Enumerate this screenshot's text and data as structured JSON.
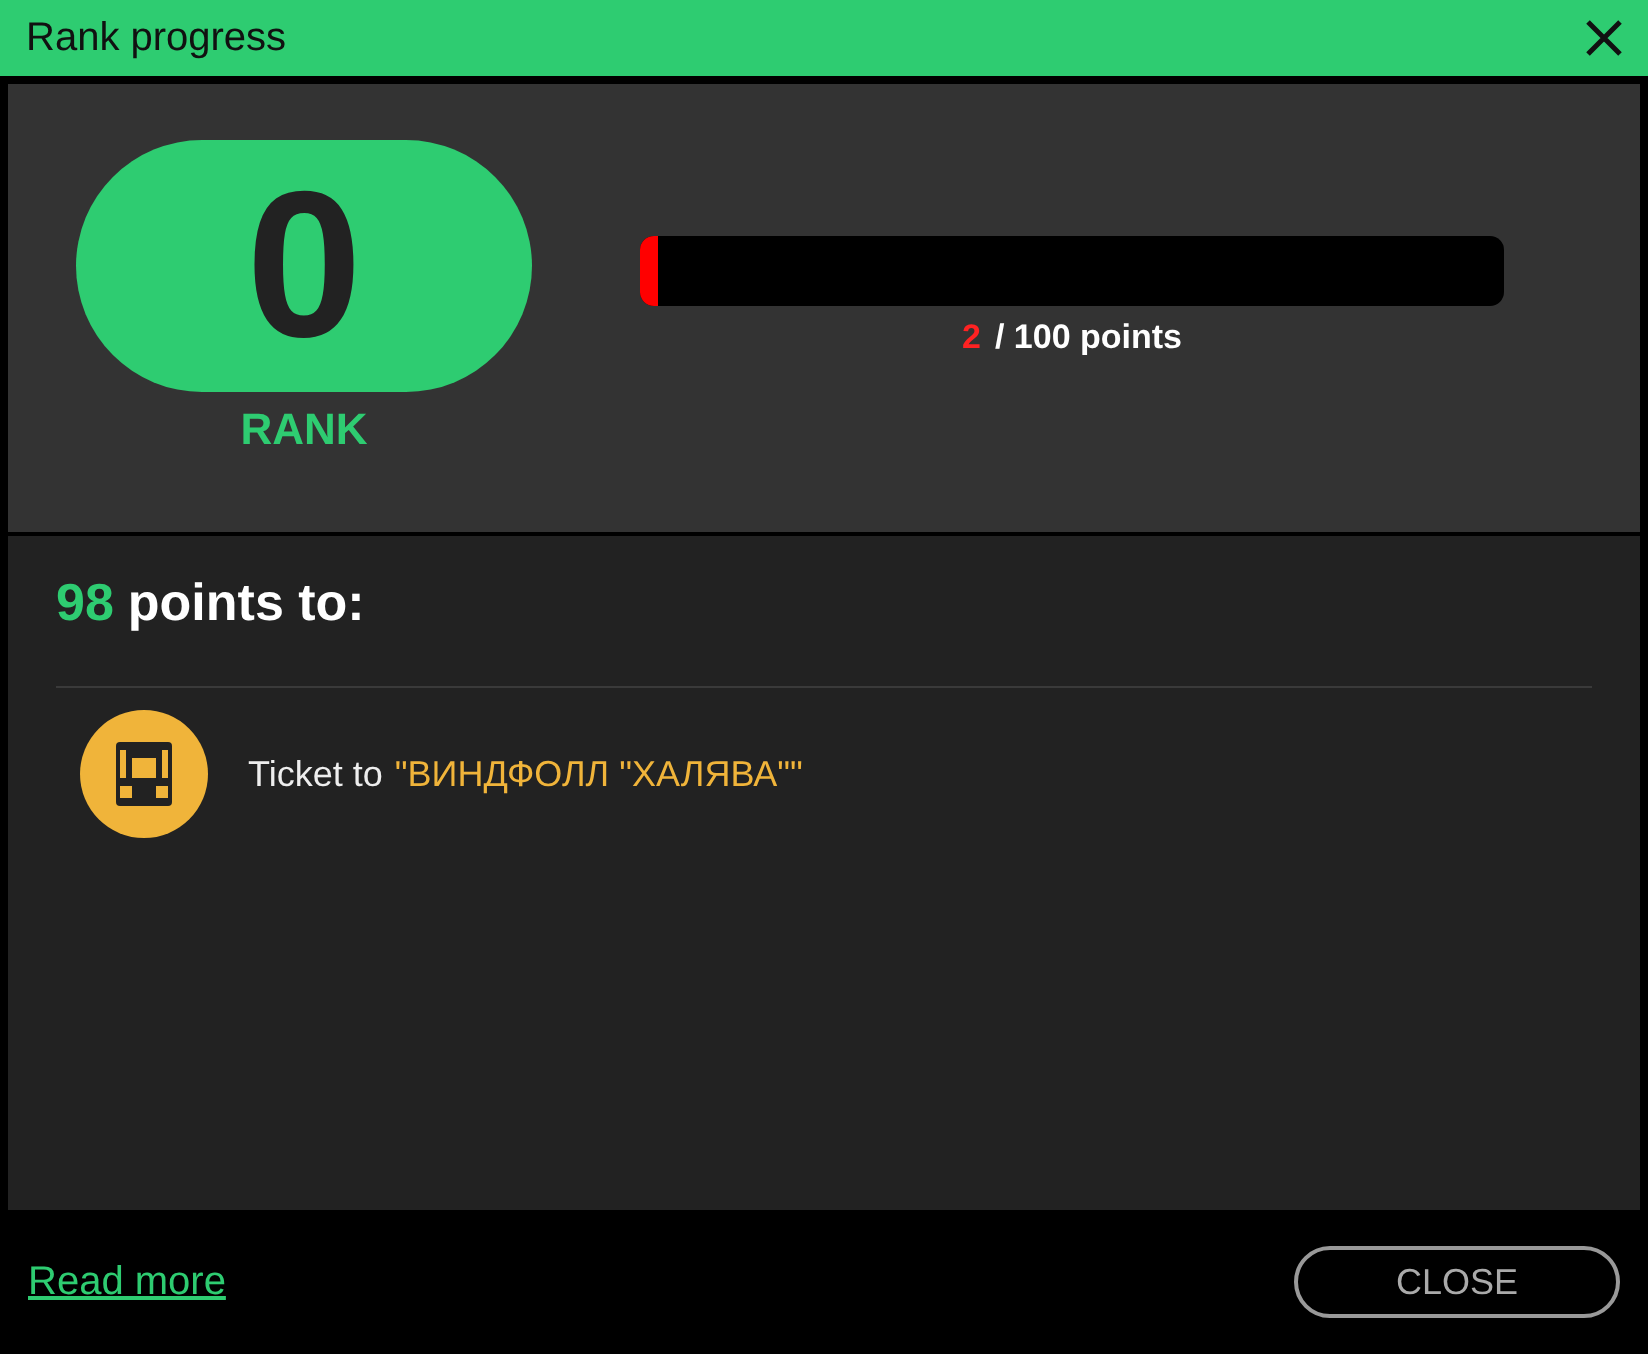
{
  "window": {
    "title": "Rank progress"
  },
  "rank": {
    "value": "0",
    "label": "RANK"
  },
  "progress": {
    "level": 0.02,
    "current": "2",
    "total": "/ 100 points"
  },
  "next": {
    "remaining": "98",
    "label": "points to:"
  },
  "rewards": [
    {
      "prefix": "Ticket to",
      "name": "\"ВИНДФОЛЛ \"ХАЛЯВА\"\""
    }
  ],
  "footer": {
    "link": "Read more",
    "button": "CLOSE"
  }
}
